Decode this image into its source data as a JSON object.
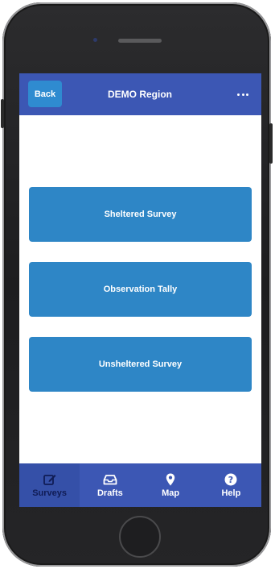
{
  "header": {
    "back_label": "Back",
    "title": "DEMO Region",
    "menu_icon": "more-icon"
  },
  "main": {
    "buttons": [
      {
        "label": "Sheltered Survey"
      },
      {
        "label": "Observation Tally"
      },
      {
        "label": "Unsheltered Survey"
      }
    ]
  },
  "tabbar": {
    "tabs": [
      {
        "label": "Surveys",
        "icon": "edit-icon",
        "active": true
      },
      {
        "label": "Drafts",
        "icon": "inbox-icon",
        "active": false
      },
      {
        "label": "Map",
        "icon": "map-pin-icon",
        "active": false
      },
      {
        "label": "Help",
        "icon": "help-icon",
        "active": false
      }
    ]
  },
  "colors": {
    "header": "#3c57b4",
    "button": "#2e86c6",
    "back_button": "#2f8bd0",
    "active_tab_text": "#101c55"
  }
}
